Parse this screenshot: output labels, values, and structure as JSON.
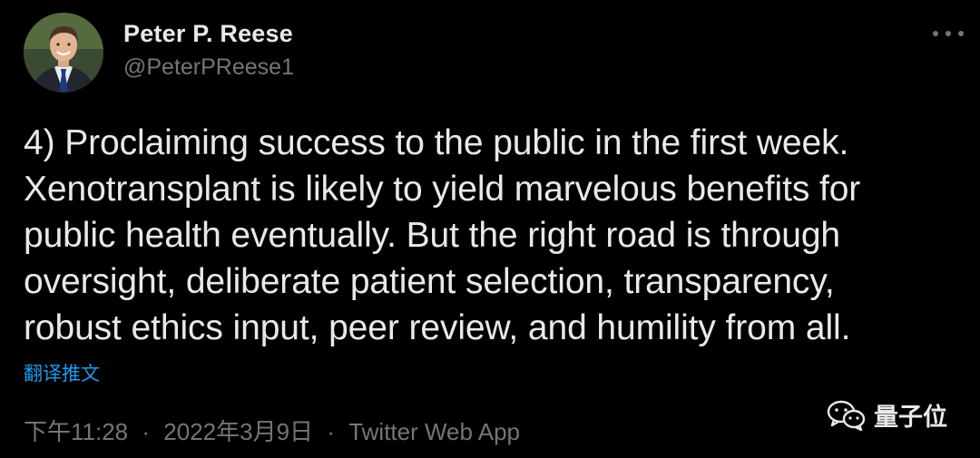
{
  "author": {
    "display_name": "Peter P. Reese",
    "handle": "@PeterPReese1"
  },
  "tweet": {
    "lines": [
      "4) Proclaiming success to the public in the first week.",
      "Xenotransplant is likely to yield marvelous benefits for",
      "public health eventually. But the right road is through",
      "oversight, deliberate patient selection, transparency,",
      "robust ethics input, peer review, and humility from all."
    ],
    "translate_label": "翻译推文"
  },
  "meta": {
    "time": "下午11:28",
    "date": "2022年3月9日",
    "separator": "·",
    "source": "Twitter Web App"
  },
  "watermark": {
    "text": "量子位",
    "icon": "wechat-icon"
  },
  "icons": {
    "more": "more-options-icon",
    "avatar": "profile-photo"
  },
  "colors": {
    "background": "#000000",
    "text": "#e7e9ea",
    "secondary": "#71767b",
    "link": "#1d9bf0"
  }
}
